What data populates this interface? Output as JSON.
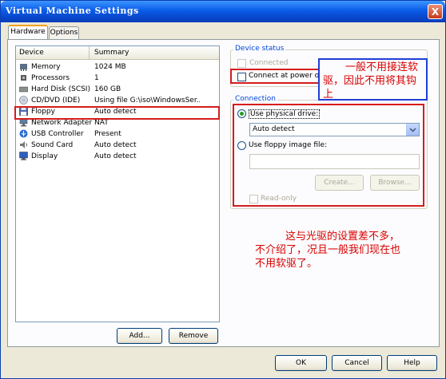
{
  "window": {
    "title": "Virtual Machine Settings",
    "close_glyph": "X"
  },
  "tabs": [
    {
      "label": "Hardware"
    },
    {
      "label": "Options"
    }
  ],
  "device_list": {
    "headers": {
      "device": "Device",
      "summary": "Summary"
    },
    "rows": [
      {
        "device": "Memory",
        "summary": "1024 MB",
        "icon": "memory-icon"
      },
      {
        "device": "Processors",
        "summary": "1",
        "icon": "processor-icon"
      },
      {
        "device": "Hard Disk (SCSI)",
        "summary": "160 GB",
        "icon": "hard-disk-icon"
      },
      {
        "device": "CD/DVD (IDE)",
        "summary": "Using file G:\\iso\\WindowsSer...",
        "icon": "cd-dvd-icon"
      },
      {
        "device": "Floppy",
        "summary": "Auto detect",
        "icon": "floppy-icon"
      },
      {
        "device": "Network Adapter",
        "summary": "NAT",
        "icon": "network-adapter-icon"
      },
      {
        "device": "USB Controller",
        "summary": "Present",
        "icon": "usb-icon"
      },
      {
        "device": "Sound Card",
        "summary": "Auto detect",
        "icon": "sound-card-icon"
      },
      {
        "device": "Display",
        "summary": "Auto detect",
        "icon": "display-icon"
      }
    ]
  },
  "buttons": {
    "add": "Add...",
    "remove": "Remove",
    "ok": "OK",
    "cancel": "Cancel",
    "help": "Help"
  },
  "device_status": {
    "title": "Device status",
    "connected": {
      "label": "Connected",
      "checked": false,
      "enabled": false
    },
    "connect_at_power_on": {
      "label": "Connect at power on",
      "checked": false
    }
  },
  "connection": {
    "title": "Connection",
    "use_physical_drive": {
      "label": "Use physical drive:",
      "selected": true
    },
    "drive_select": {
      "value": "Auto detect"
    },
    "use_floppy_image": {
      "label": "Use floppy image file:",
      "selected": false
    },
    "image_path": {
      "value": ""
    },
    "create_button": "Create...",
    "browse_button": "Browse...",
    "read_only": {
      "label": "Read-only",
      "checked": false,
      "enabled": false
    }
  },
  "annotations": {
    "note1": "一般不用接连软驱，因此不用将其钩上",
    "note2": "这与光驱的设置差不多，不介绍了，况且一般我们现在也不用软驱了。"
  },
  "colors": {
    "title_bar": "#0a5ce8",
    "annotation_red": "#d90000",
    "annotation_blue_border": "#1f3fd6",
    "highlight_red_border": "#d51c1c"
  }
}
